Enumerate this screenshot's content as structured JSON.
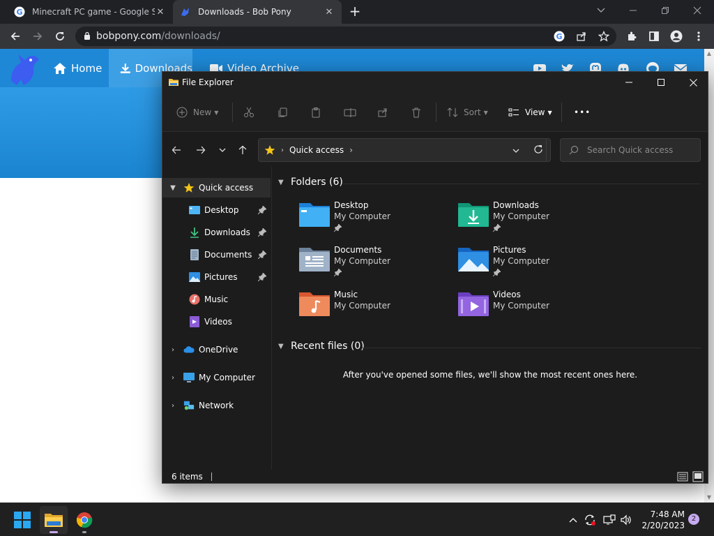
{
  "browser": {
    "tabs": [
      {
        "title": "Minecraft PC game - Google Sea",
        "active": false
      },
      {
        "title": "Downloads - Bob Pony",
        "active": true
      }
    ],
    "new_tab": "+",
    "url_host": "bobpony.com",
    "url_path": "/downloads/"
  },
  "site": {
    "nav": [
      {
        "label": "Home"
      },
      {
        "label": "Downloads"
      },
      {
        "label": "Video Archive"
      }
    ],
    "colors": {
      "nav": "#1e88d6",
      "hero": "#2f9be6"
    }
  },
  "explorer": {
    "title": "File Explorer",
    "commands": {
      "new": "New",
      "sort": "Sort",
      "view": "View",
      "more": "•••"
    },
    "address": "Quick access",
    "search_placeholder": "Search Quick access",
    "sidebar": [
      {
        "label": "Quick access",
        "icon": "star-icon",
        "expanded": true,
        "selected": true
      },
      {
        "label": "Desktop",
        "icon": "desktop-icon",
        "pinned": true
      },
      {
        "label": "Downloads",
        "icon": "download-icon",
        "pinned": true
      },
      {
        "label": "Documents",
        "icon": "documents-icon",
        "pinned": true
      },
      {
        "label": "Pictures",
        "icon": "pictures-icon",
        "pinned": true
      },
      {
        "label": "Music",
        "icon": "music-icon",
        "pinned": false
      },
      {
        "label": "Videos",
        "icon": "videos-icon",
        "pinned": false
      },
      {
        "label": "OneDrive",
        "icon": "cloud-icon",
        "expanded": false
      },
      {
        "label": "My Computer",
        "icon": "computer-icon",
        "expanded": false
      },
      {
        "label": "Network",
        "icon": "network-icon",
        "expanded": false
      }
    ],
    "folders_header": "Folders (6)",
    "folders": [
      {
        "name": "Desktop",
        "location": "My Computer",
        "pinned": true
      },
      {
        "name": "Downloads",
        "location": "My Computer",
        "pinned": true
      },
      {
        "name": "Documents",
        "location": "My Computer",
        "pinned": true
      },
      {
        "name": "Pictures",
        "location": "My Computer",
        "pinned": true
      },
      {
        "name": "Music",
        "location": "My Computer",
        "pinned": false
      },
      {
        "name": "Videos",
        "location": "My Computer",
        "pinned": false
      }
    ],
    "recent_header": "Recent files (0)",
    "recent_empty": "After you've opened some files, we'll show the most recent ones here.",
    "status": "6 items"
  },
  "taskbar": {
    "time": "7:48 AM",
    "date": "2/20/2023",
    "notification_count": "2"
  }
}
